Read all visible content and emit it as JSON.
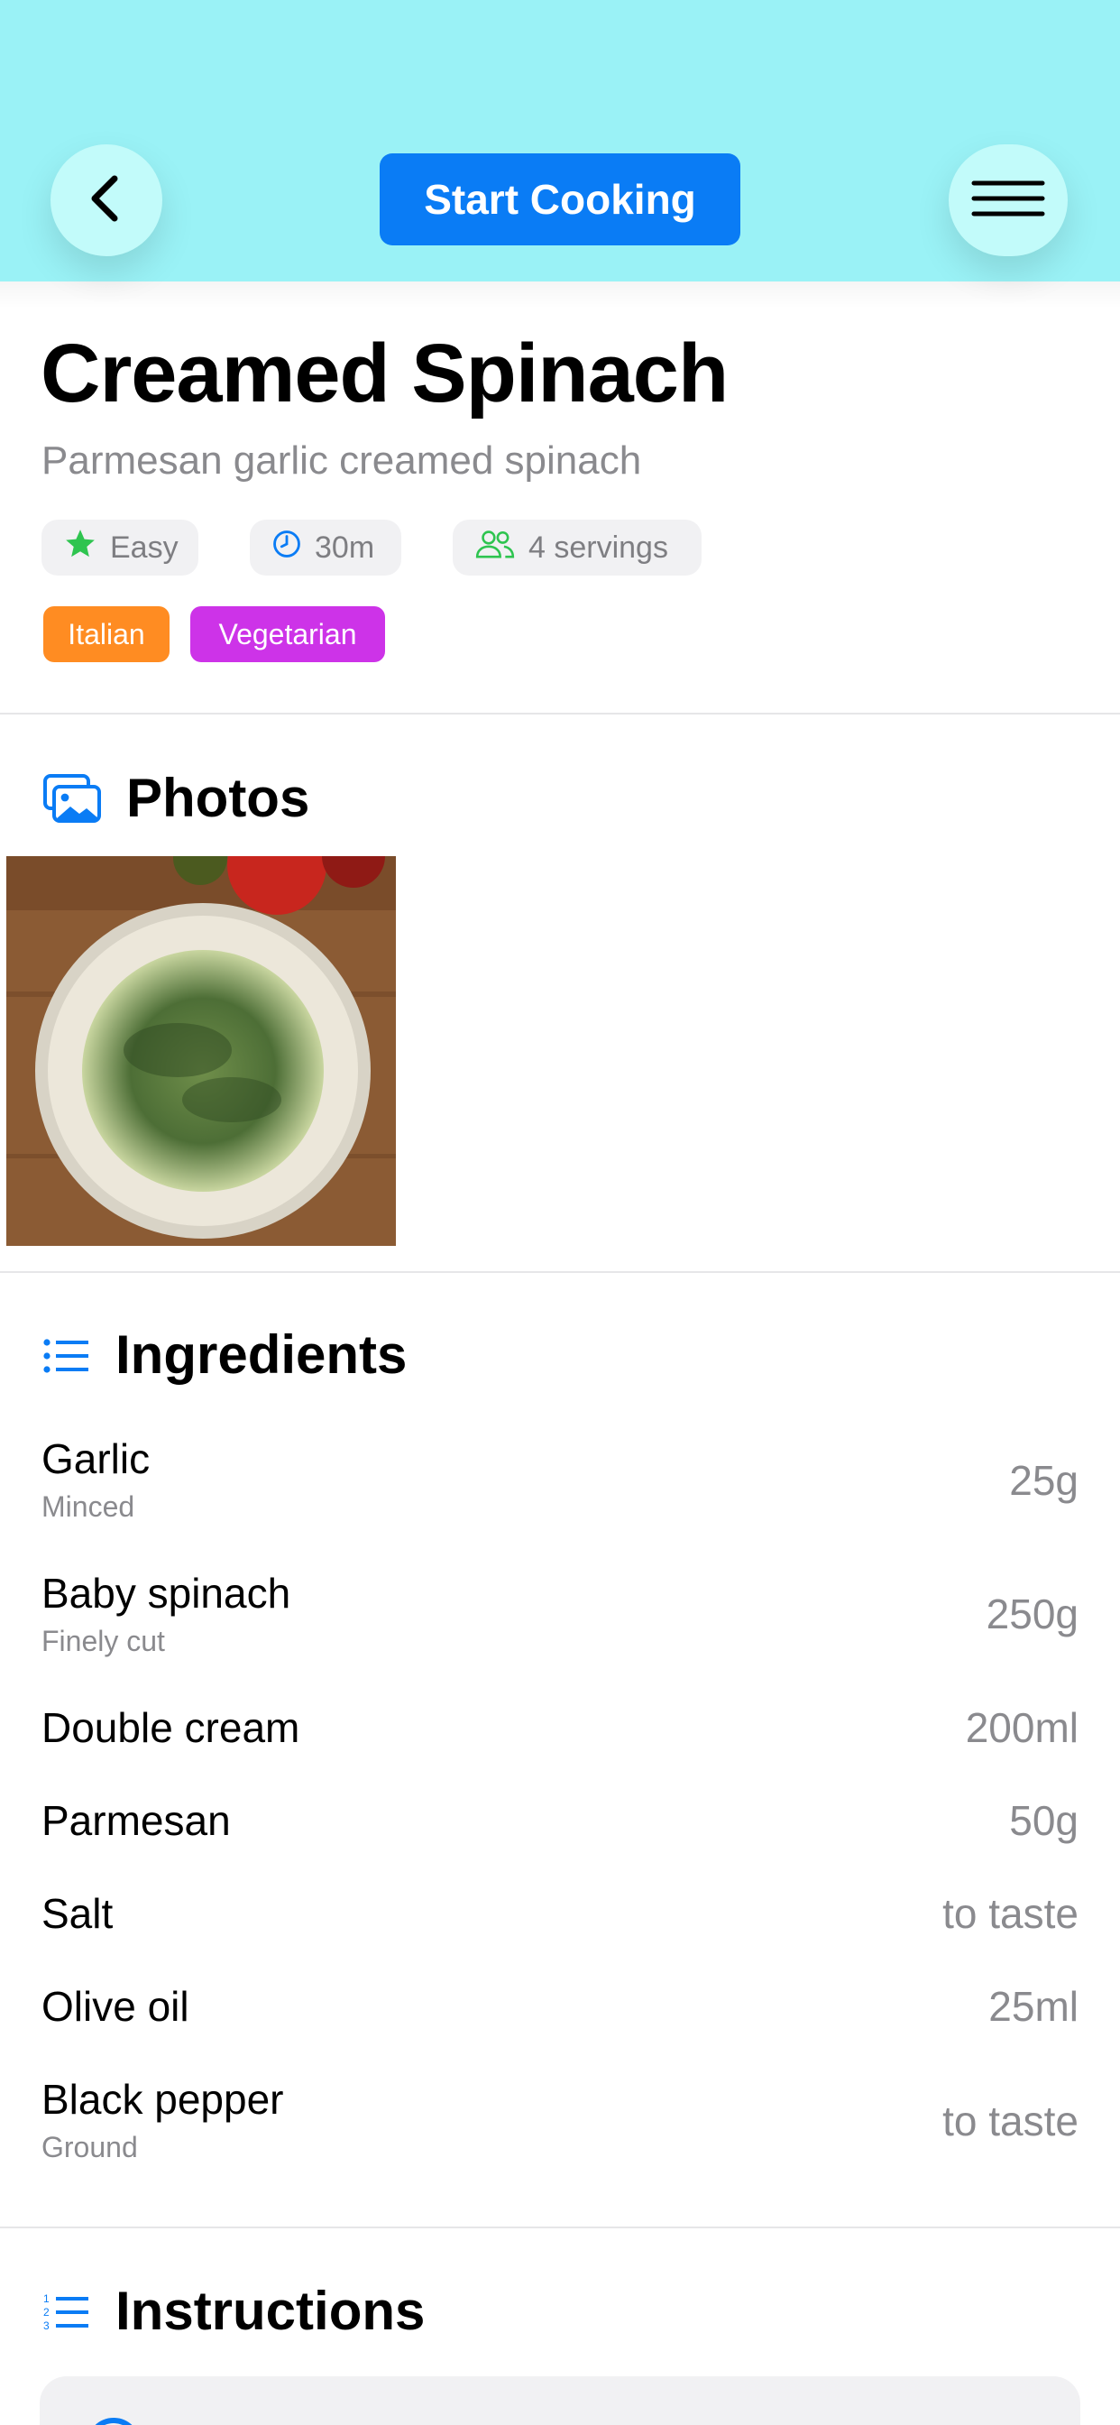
{
  "header": {
    "start_label": "Start Cooking"
  },
  "recipe": {
    "title": "Creamed Spinach",
    "subtitle": "Parmesan garlic creamed spinach",
    "difficulty": "Easy",
    "time": "30m",
    "servings": "4 servings",
    "tags": [
      "Italian",
      "Vegetarian"
    ]
  },
  "photos": {
    "title": "Photos"
  },
  "ingredients": {
    "title": "Ingredients",
    "items": [
      {
        "name": "Garlic",
        "note": "Minced",
        "qty": "25g"
      },
      {
        "name": "Baby spinach",
        "note": "Finely cut",
        "qty": "250g"
      },
      {
        "name": "Double cream",
        "note": "",
        "qty": "200ml"
      },
      {
        "name": "Parmesan",
        "note": "",
        "qty": "50g"
      },
      {
        "name": "Salt",
        "note": "",
        "qty": "to taste"
      },
      {
        "name": "Olive oil",
        "note": "",
        "qty": "25ml"
      },
      {
        "name": "Black pepper",
        "note": "Ground",
        "qty": "to taste"
      }
    ]
  },
  "instructions": {
    "title": "Instructions"
  },
  "colors": {
    "header_bg": "#9af2f6",
    "accent": "#0a7cf5",
    "tag_italian": "#ff8c22",
    "tag_vegetarian": "#cd33e8",
    "difficulty_star": "#2ec44f"
  },
  "icons": {
    "back": "chevron-left-icon",
    "menu": "hamburger-icon",
    "difficulty": "star-icon",
    "time": "clock-icon",
    "servings": "people-icon",
    "photos": "photos-icon",
    "ingredients": "list-icon",
    "instructions": "numbered-list-icon"
  }
}
